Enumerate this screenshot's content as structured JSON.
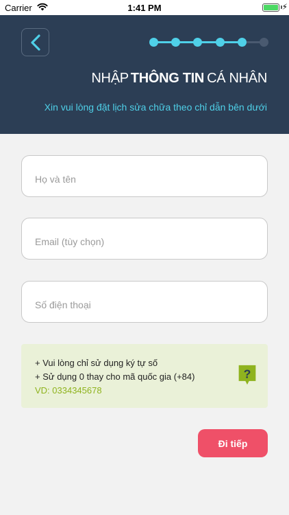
{
  "status_bar": {
    "carrier": "Carrier",
    "time": "1:41 PM",
    "wifi_icon": "wifi-icon",
    "battery_icon": "battery-icon",
    "charging_icon": "bolt-icon"
  },
  "header": {
    "back_icon": "chevron-left-icon",
    "title_prefix": "NHẬP",
    "title_bold": "THÔNG TIN",
    "title_suffix": "CÁ NHÂN",
    "subtitle": "Xin vui lòng đặt lịch sửa chữa theo chỉ dẫn bên dưới",
    "progress": {
      "total_steps": 6,
      "completed_steps": 5,
      "active_color": "#4fd0e8",
      "inactive_color": "#4a5a70"
    }
  },
  "form": {
    "name_placeholder": "Họ và tên",
    "email_placeholder": "Email (tùy chọn)",
    "phone_placeholder": "Số điện thoại"
  },
  "info": {
    "line1": "+ Vui lòng chỉ sử dụng ký tự số",
    "line2": "+ Sử dụng 0 thay cho mã quốc gia (+84)",
    "example": "VD: 0334345678",
    "help_icon": "question-mark-icon",
    "help_icon_color": "#8fb31e"
  },
  "actions": {
    "next_label": "Đi tiếp",
    "next_color": "#ef5068"
  }
}
